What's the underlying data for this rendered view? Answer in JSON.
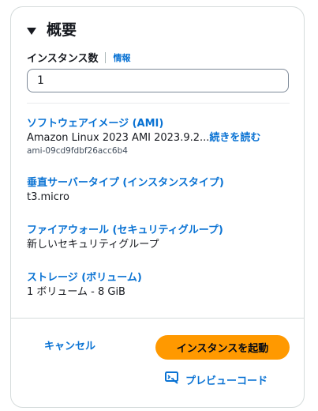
{
  "summary": {
    "title": "概要",
    "instance_count": {
      "label": "インスタンス数",
      "info_link": "情報",
      "value": "1"
    },
    "sections": [
      {
        "link": "ソフトウェアイメージ (AMI)",
        "value": "Amazon Linux 2023 AMI 2023.9.2...",
        "more": "続きを読む",
        "sub": "ami-09cd9fdbf26acc6b4"
      },
      {
        "link": "垂直サーバータイプ (インスタンスタイプ)",
        "value": "t3.micro"
      },
      {
        "link": "ファイアウォール (セキュリティグループ)",
        "value": "新しいセキュリティグループ"
      },
      {
        "link": "ストレージ (ボリューム)",
        "value": "1 ボリューム - 8 GiB"
      }
    ],
    "actions": {
      "cancel": "キャンセル",
      "launch": "インスタンスを起動",
      "preview_code": "プレビューコード"
    }
  },
  "colors": {
    "link": "#0972d3",
    "primary_button": "#ff9900"
  },
  "icons": {
    "header_toggle": "caret-down-icon",
    "preview": "preview-code-icon"
  }
}
